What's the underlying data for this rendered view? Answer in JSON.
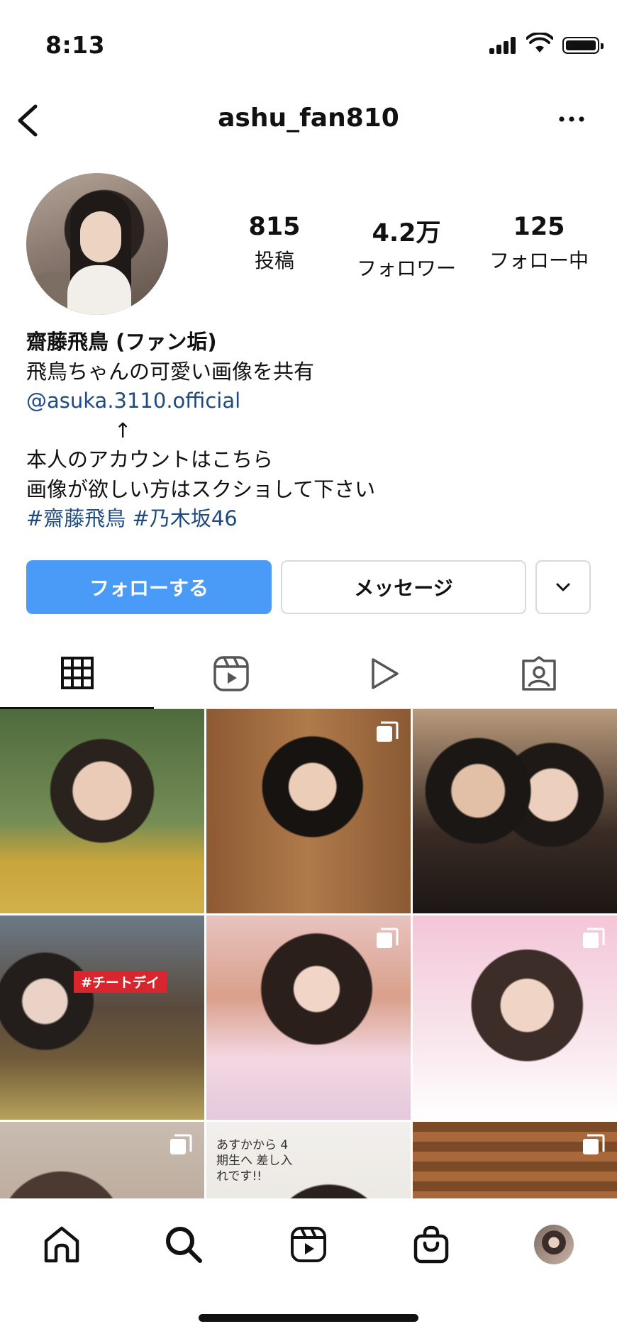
{
  "status_bar": {
    "time": "8:13"
  },
  "header": {
    "username": "ashu_fan810"
  },
  "profile": {
    "stats": [
      {
        "value": "815",
        "label": "投稿"
      },
      {
        "value": "4.2万",
        "label": "フォロワー"
      },
      {
        "value": "125",
        "label": "フォロー中"
      }
    ],
    "bio": {
      "name": "齋藤飛鳥 (ファン垢)",
      "line1": "飛鳥ちゃんの可愛い画像を共有",
      "mention": "@asuka.3110.official",
      "arrow": "↑",
      "line2": "本人のアカウントはこちら",
      "line3": "画像が欲しい方はスクショして下さい",
      "hashtags": "#齋藤飛鳥 #乃木坂46"
    }
  },
  "actions": {
    "follow_label": "フォローする",
    "message_label": "メッセージ"
  },
  "grid": {
    "thumbnail_texts": {
      "tag": "#チートデイ",
      "note": "あすかから 4期生へ 差し入れです!!"
    }
  },
  "colors": {
    "follow_button": "#4a9bf7",
    "link": "#1f4a82"
  }
}
